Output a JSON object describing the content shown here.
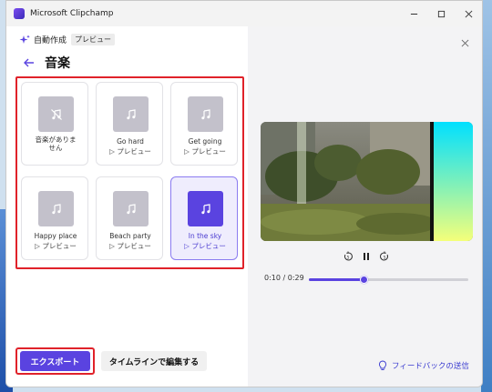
{
  "window": {
    "title": "Microsoft Clipchamp"
  },
  "header": {
    "auto_label": "自動作成",
    "preview_badge": "プレビュー",
    "section_title": "音楽"
  },
  "music_options": [
    {
      "title": "音楽がありま\nせん",
      "subtitle": "",
      "icon": "music-off-icon",
      "selected": false
    },
    {
      "title": "Go hard",
      "subtitle": "▷ プレビュー",
      "icon": "music-note-icon",
      "selected": false
    },
    {
      "title": "Get going",
      "subtitle": "▷ プレビュー",
      "icon": "music-note-icon",
      "selected": false
    },
    {
      "title": "Happy place",
      "subtitle": "▷ プレビュー",
      "icon": "music-note-icon",
      "selected": false
    },
    {
      "title": "Beach party",
      "subtitle": "▷ プレビュー",
      "icon": "music-note-icon",
      "selected": false
    },
    {
      "title": "In the sky",
      "subtitle": "▷ プレビュー",
      "icon": "music-note-icon",
      "selected": true
    }
  ],
  "actions": {
    "export": "エクスポート",
    "edit_timeline": "タイムラインで編集する"
  },
  "player": {
    "time": "0:10 / 0:29",
    "progress": 0.345
  },
  "feedback": {
    "label": "フィードバックの送信"
  },
  "colors": {
    "accent": "#5a43e0",
    "highlight_frame": "#e0222a"
  }
}
